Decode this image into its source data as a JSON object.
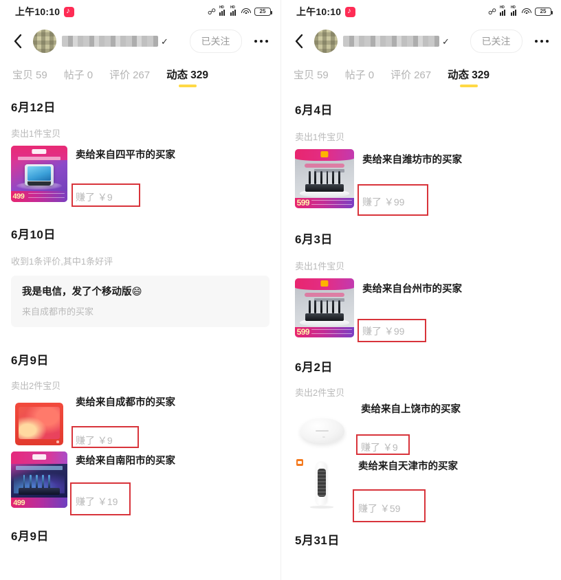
{
  "status_bar": {
    "time": "上午10:10",
    "app_icon": "douyin-music-icon",
    "bluetooth_icon": "bluetooth-icon",
    "signal_label": "HD",
    "wifi_icon": "wifi-icon",
    "battery_level": "25"
  },
  "nav": {
    "back_icon": "back-arrow-icon",
    "avatar": "user-avatar",
    "username_masked": "",
    "verified_badge": "✓",
    "follow_label": "已关注",
    "more_icon": "more-options-icon"
  },
  "tabs": [
    {
      "label": "宝贝",
      "count": "59",
      "active": false
    },
    {
      "label": "帖子",
      "count": "0",
      "active": false
    },
    {
      "label": "评价",
      "count": "267",
      "active": false
    },
    {
      "label": "动态",
      "count": "329",
      "active": true
    }
  ],
  "left_screen": {
    "sections": [
      {
        "date": "6月12日",
        "summary": "卖出1件宝贝",
        "items": [
          {
            "buyer": "卖给来自四平市的买家",
            "profit": "赚了 ￥9",
            "highlighted": true,
            "thumb": "smart-display-ad",
            "price_tag": "499"
          }
        ]
      },
      {
        "date": "6月10日",
        "summary": "收到1条评价,其中1条好评",
        "review": {
          "text": "我是电信，发了个移动版😄",
          "from": "来自成都市的买家"
        }
      },
      {
        "date": "6月9日",
        "summary": "卖出2件宝贝",
        "items": [
          {
            "buyer": "卖给来自成都市的买家",
            "profit": "赚了 ￥9",
            "highlighted": true,
            "thumb": "red-tablet"
          },
          {
            "buyer": "卖给来自南阳市的买家",
            "profit": "赚了 ￥19",
            "highlighted": true,
            "thumb": "router-ad-dark",
            "price_tag": "499"
          }
        ]
      },
      {
        "date": "6月9日",
        "summary": "",
        "items": []
      }
    ]
  },
  "right_screen": {
    "sections": [
      {
        "date": "6月4日",
        "summary": "卖出1件宝贝",
        "items": [
          {
            "buyer": "卖给来自潍坊市的买家",
            "profit": "赚了 ￥99",
            "highlighted": true,
            "thumb": "router-599",
            "price_tag": "599"
          }
        ]
      },
      {
        "date": "6月3日",
        "summary": "卖出1件宝贝",
        "items": [
          {
            "buyer": "卖给来自台州市的买家",
            "profit": "赚了 ￥99",
            "highlighted": true,
            "thumb": "router-599",
            "price_tag": "599"
          }
        ]
      },
      {
        "date": "6月2日",
        "summary": "卖出2件宝贝",
        "items": [
          {
            "buyer": "卖给来自上饶市的买家",
            "profit": "赚了 ￥9",
            "highlighted": true,
            "thumb": "white-puck"
          },
          {
            "buyer": "卖给来自天津市的买家",
            "profit": "赚了 ￥59",
            "highlighted": true,
            "thumb": "tower-fan"
          }
        ]
      },
      {
        "date": "5月31日",
        "summary": "",
        "items": []
      }
    ]
  },
  "colors": {
    "highlight_border": "#d8333a",
    "tab_underline": "#ffd945",
    "primary_text": "#1a1a1a",
    "muted_text": "#b9b9b9"
  }
}
